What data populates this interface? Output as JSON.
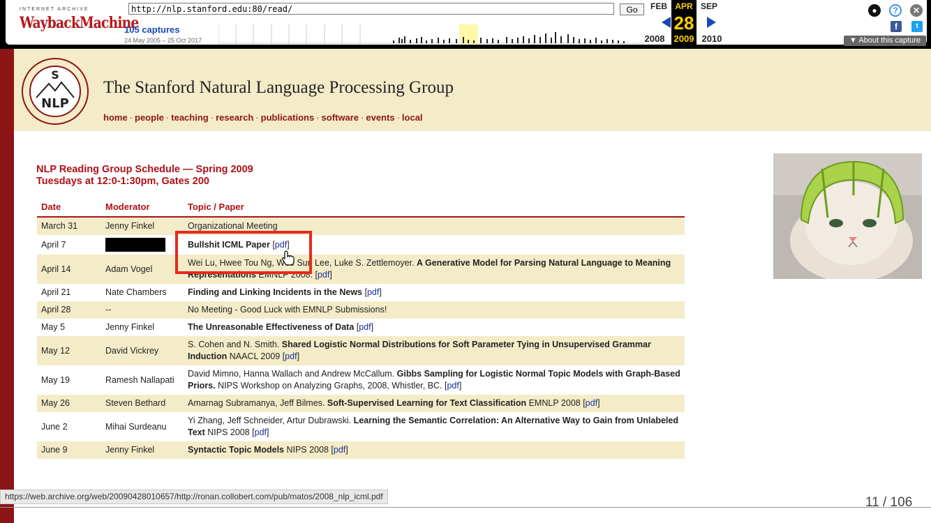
{
  "wayback": {
    "logo_small": "INTERNET ARCHIVE",
    "logo_big": "WaybackMachine",
    "url": "http://nlp.stanford.edu:80/read/",
    "go_label": "Go",
    "captures": "105 captures",
    "capture_range": "24 May 2005 – 25 Oct 2017",
    "months": {
      "prev": "FEB",
      "current": "APR",
      "next": "SEP"
    },
    "day": "28",
    "years": {
      "prev": "2008",
      "current": "2009",
      "next": "2010"
    },
    "about": "▼ About this capture",
    "icons": [
      "user-icon",
      "help-icon",
      "close-icon",
      "facebook-icon",
      "twitter-icon"
    ]
  },
  "site": {
    "title": "The Stanford Natural Language Processing Group",
    "logo_text": "NLP",
    "logo_letter": "S",
    "nav": [
      "home",
      "people",
      "teaching",
      "research",
      "publications",
      "software",
      "events",
      "local"
    ],
    "nav_separator": "·"
  },
  "schedule": {
    "title_line1": "NLP Reading Group Schedule — Spring 2009",
    "title_line2": "Tuesdays at 12:0-1:30pm, Gates 200",
    "headers": [
      "Date",
      "Moderator",
      "Topic / Paper"
    ],
    "rows": [
      {
        "date": "March 31",
        "moderator": "Jenny Finkel",
        "pre": "Organizational Meeting",
        "bold": "",
        "post": "",
        "pdf": ""
      },
      {
        "date": "April 7",
        "moderator": "",
        "redacted": true,
        "pre": "",
        "bold": "Bullshit ICML Paper",
        "post": " [",
        "pdf": "pdf",
        "end": "]"
      },
      {
        "date": "April 14",
        "moderator": "Adam Vogel",
        "pre": "Wei Lu, Hwee Tou Ng, Wee Sun Lee, Luke S. Zettlemoyer. ",
        "bold": "A Generative Model for Parsing Natural Language to Meaning Representations",
        "post": " EMNLP 2008. [",
        "pdf": "pdf",
        "end": "]"
      },
      {
        "date": "April 21",
        "moderator": "Nate Chambers",
        "pre": "",
        "bold": "Finding and Linking Incidents in the News",
        "post": " [",
        "pdf": "pdf",
        "end": "]"
      },
      {
        "date": "April 28",
        "moderator": "--",
        "pre": "No Meeting - Good Luck with EMNLP Submissions!",
        "bold": "",
        "post": "",
        "pdf": ""
      },
      {
        "date": "May 5",
        "moderator": "Jenny Finkel",
        "pre": "",
        "bold": "The Unreasonable Effectiveness of Data",
        "post": " [",
        "pdf": "pdf",
        "end": "]"
      },
      {
        "date": "May 12",
        "moderator": "David Vickrey",
        "pre": "S. Cohen and N. Smith. ",
        "bold": "Shared Logistic Normal Distributions for Soft Parameter Tying in Unsupervised Grammar Induction",
        "post": " NAACL 2009 [",
        "pdf": "pdf",
        "end": "]"
      },
      {
        "date": "May 19",
        "moderator": "Ramesh Nallapati",
        "pre": "David Mimno, Hanna Wallach and Andrew McCallum. ",
        "bold": "Gibbs Sampling for Logistic Normal Topic Models with Graph-Based Priors.",
        "post": " NIPS Workshop on Analyzing Graphs, 2008, Whistler, BC. [",
        "pdf": "pdf",
        "end": "]"
      },
      {
        "date": "May 26",
        "moderator": "Steven Bethard",
        "pre": "Amarnag Subramanya, Jeff Bilmes. ",
        "bold": "Soft-Supervised Learning for Text Classification",
        "post": " EMNLP 2008 [",
        "pdf": "pdf",
        "end": "]"
      },
      {
        "date": "June 2",
        "moderator": "Mihai Surdeanu",
        "pre": "Yi Zhang, Jeff Schneider, Artur Dubrawski. ",
        "bold": "Learning the Semantic Correlation: An Alternative Way to Gain from Unlabeled Text",
        "post": " NIPS 2008 [",
        "pdf": "pdf",
        "end": "]"
      },
      {
        "date": "June 9",
        "moderator": "Jenny Finkel",
        "pre": "",
        "bold": "Syntactic Topic Models",
        "post": " NIPS 2008 [",
        "pdf": "pdf",
        "end": "]"
      }
    ]
  },
  "status_url": "https://web.archive.org/web/20090428010657/http://ronan.collobert.com/pub/matos/2008_nlp_icml.pdf",
  "slide_counter": "11 / 106",
  "colors": {
    "stanford_red": "#8c1515",
    "band": "#f4ecc9",
    "highlight": "#e62a1c",
    "link": "#1a2e9e"
  }
}
